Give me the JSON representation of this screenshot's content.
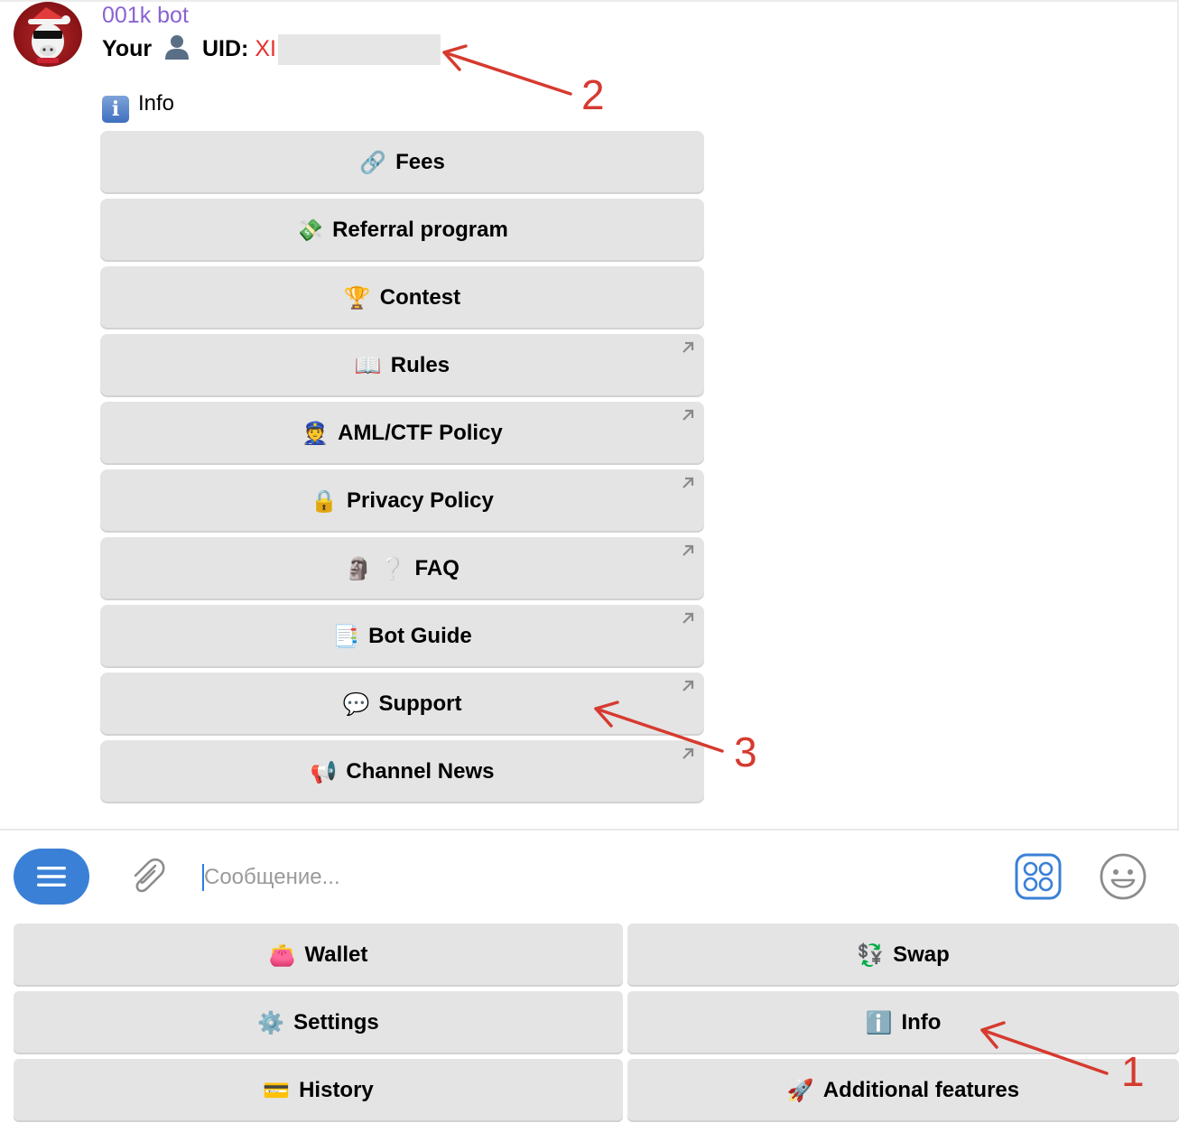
{
  "message": {
    "bot_name": "001k bot",
    "uid_prefix": "Your",
    "uid_label": "UID:",
    "uid_value": "XI",
    "person_icon": "bust-in-silhouette-icon",
    "section_label": "Info",
    "section_icon": "information-icon"
  },
  "inline_buttons": [
    {
      "emoji": "🔗",
      "icon": "link-icon",
      "label": "Fees",
      "external": false
    },
    {
      "emoji": "💸",
      "icon": "money-with-wings-icon",
      "label": "Referral program",
      "external": false
    },
    {
      "emoji": "🏆",
      "icon": "trophy-icon",
      "label": "Contest",
      "external": false
    },
    {
      "emoji": "📖",
      "icon": "open-book-icon",
      "label": "Rules",
      "external": true
    },
    {
      "emoji": "👮",
      "icon": "police-officer-icon",
      "label": "AML/CTF Policy",
      "external": true
    },
    {
      "emoji": "🔒",
      "icon": "lock-icon",
      "label": "Privacy Policy",
      "external": true
    },
    {
      "emoji": "🗿 ❔",
      "icon": "moai-question-icon",
      "label": "FAQ",
      "external": true
    },
    {
      "emoji": "📑",
      "icon": "bookmark-tabs-icon",
      "label": "Bot Guide",
      "external": true
    },
    {
      "emoji": "💬",
      "icon": "speech-balloon-icon",
      "label": "Support",
      "external": true
    },
    {
      "emoji": "📢",
      "icon": "loudspeaker-icon",
      "label": "Channel News",
      "external": true
    }
  ],
  "composer": {
    "placeholder": "Сообщение..."
  },
  "reply_keyboard": [
    {
      "emoji": "👛",
      "icon": "purse-icon",
      "label": "Wallet"
    },
    {
      "emoji": "💱",
      "icon": "currency-exchange-icon",
      "label": "Swap"
    },
    {
      "emoji": "⚙️",
      "icon": "gear-icon",
      "label": "Settings"
    },
    {
      "emoji": "ℹ️",
      "icon": "information-icon",
      "label": "Info"
    },
    {
      "emoji": "💳",
      "icon": "credit-card-icon",
      "label": "History"
    },
    {
      "emoji": "🚀",
      "icon": "rocket-icon",
      "label": "Additional features"
    }
  ],
  "annotations": [
    "1",
    "2",
    "3"
  ],
  "colors": {
    "accent": "#3a80d6",
    "bot_name": "#8a63d2",
    "uid": "#e5322d",
    "annotation": "#d63a2f",
    "button_bg": "#e4e4e4"
  }
}
